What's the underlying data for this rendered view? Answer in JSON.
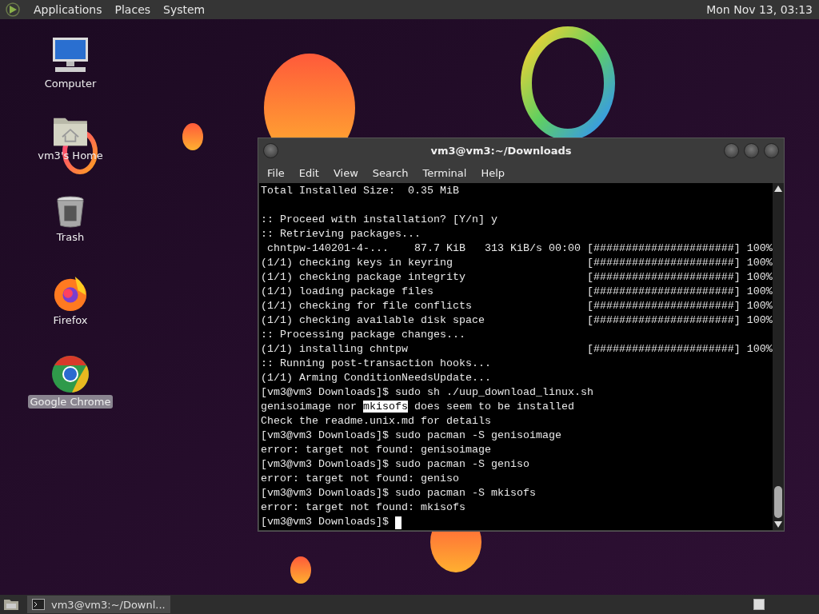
{
  "top_panel": {
    "menus": [
      "Applications",
      "Places",
      "System"
    ],
    "clock": "Mon Nov 13, 03:13"
  },
  "desktop_icons": [
    {
      "kind": "computer",
      "label": "Computer",
      "selected": false
    },
    {
      "kind": "home",
      "label": "vm3's Home",
      "selected": false
    },
    {
      "kind": "trash",
      "label": "Trash",
      "selected": false
    },
    {
      "kind": "firefox",
      "label": "Firefox",
      "selected": false
    },
    {
      "kind": "chrome",
      "label": "Google Chrome",
      "selected": true
    }
  ],
  "terminal": {
    "title": "vm3@vm3:~/Downloads",
    "menu": [
      "File",
      "Edit",
      "View",
      "Search",
      "Terminal",
      "Help"
    ],
    "lines": [
      {
        "text": "Total Installed Size:  0.35 MiB"
      },
      {
        "text": ":: Proceed with installation? [Y/n] y",
        "blank_line_before": true
      },
      {
        "text": ":: Retrieving packages..."
      },
      {
        "text": " chntpw-140201-4-...    87.7 KiB   313 KiB/s 00:00",
        "bar": "[######################] 100%"
      },
      {
        "text": "(1/1) checking keys in keyring",
        "bar": "[######################] 100%"
      },
      {
        "text": "(1/1) checking package integrity",
        "bar": "[######################] 100%"
      },
      {
        "text": "(1/1) loading package files",
        "bar": "[######################] 100%"
      },
      {
        "text": "(1/1) checking for file conflicts",
        "bar": "[######################] 100%"
      },
      {
        "text": "(1/1) checking available disk space",
        "bar": "[######################] 100%"
      },
      {
        "text": ":: Processing package changes..."
      },
      {
        "text": "(1/1) installing chntpw",
        "bar": "[######################] 100%"
      },
      {
        "text": ":: Running post-transaction hooks..."
      },
      {
        "text": "(1/1) Arming ConditionNeedsUpdate..."
      },
      {
        "text": "[vm3@vm3 Downloads]$ sudo sh ./uup_download_linux.sh"
      },
      {
        "text": "genisoimage nor ",
        "selection": "mkisofs",
        "rest": " does seem to be installed"
      },
      {
        "text": "Check the readme.unix.md for details"
      },
      {
        "text": "[vm3@vm3 Downloads]$ sudo pacman -S genisoimage"
      },
      {
        "text": "error: target not found: genisoimage"
      },
      {
        "text": "[vm3@vm3 Downloads]$ sudo pacman -S geniso"
      },
      {
        "text": "error: target not found: geniso"
      },
      {
        "text": "[vm3@vm3 Downloads]$ sudo pacman -S mkisofs"
      },
      {
        "text": "error: target not found: mkisofs"
      },
      {
        "text": "[vm3@vm3 Downloads]$ ",
        "cursor": true
      }
    ]
  },
  "taskbar": {
    "tasks": [
      {
        "label": "vm3@vm3:~/Downl...",
        "selected": true
      }
    ]
  }
}
